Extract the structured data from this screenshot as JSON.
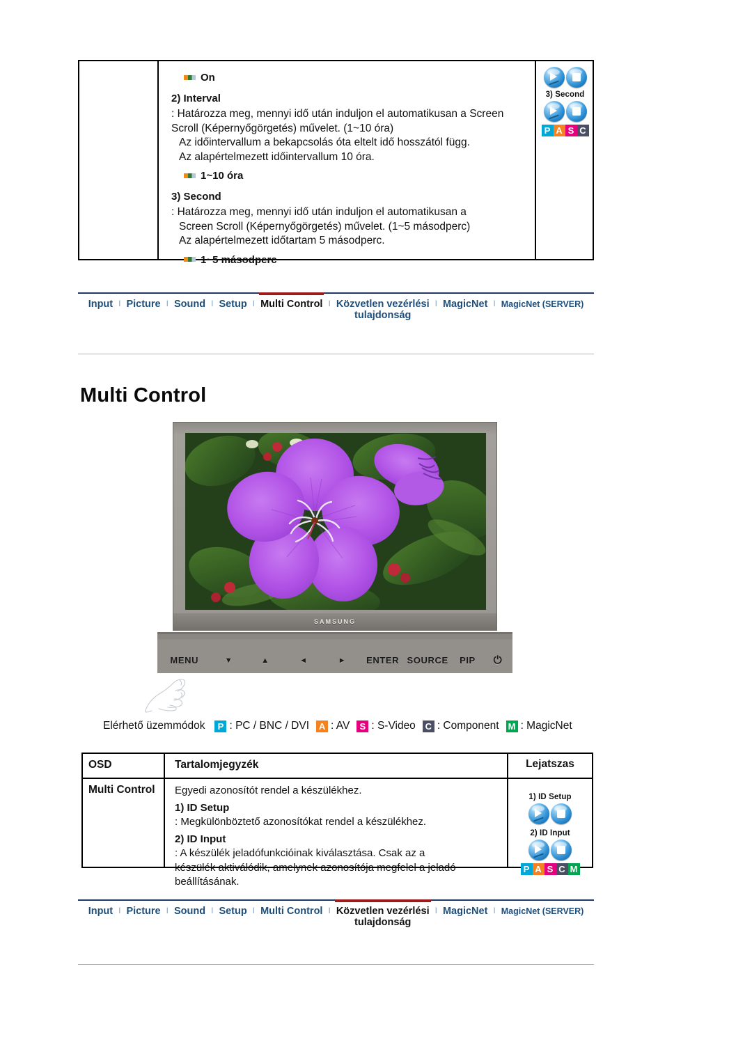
{
  "top_section": {
    "bullet_on": "On",
    "item2": {
      "title": "2) Interval",
      "lines": [
        ": Határozza meg, mennyi idő után induljon el automatikusan a Screen",
        "Scroll (Képernyőgörgetés) művelet. (1~10 óra)",
        "Az időintervallum a bekapcsolás óta eltelt idő hosszától függ.",
        "Az alapértelmezett időintervallum 10 óra."
      ],
      "bullet": "1~10 óra"
    },
    "item3": {
      "title": "3) Second",
      "lines": [
        ": Határozza meg, mennyi idő után induljon el automatikusan a",
        "Screen Scroll (Képernyőgörgetés) művelet. (1~5 másodperc)",
        "Az alapértelmezett időtartam 5 másodperc."
      ],
      "bullet": "1~5 másodperc"
    },
    "icon_label": "3) Second",
    "pasc": [
      "P",
      "A",
      "S",
      "C"
    ]
  },
  "nav_top": {
    "items": [
      {
        "label": "Input",
        "active": false
      },
      {
        "label": "Picture",
        "active": false
      },
      {
        "label": "Sound",
        "active": false
      },
      {
        "label": "Setup",
        "active": false
      },
      {
        "label": "Multi Control",
        "active": true
      },
      {
        "label": "Közvetlen vezérlési tulajdonság",
        "active": false
      },
      {
        "label": "MagicNet",
        "active": false
      },
      {
        "label": "MagicNet (SERVER)",
        "active": false
      }
    ],
    "separator": "I"
  },
  "nav_bottom": {
    "items": [
      {
        "label": "Input",
        "active": false
      },
      {
        "label": "Picture",
        "active": false
      },
      {
        "label": "Sound",
        "active": false
      },
      {
        "label": "Setup",
        "active": false
      },
      {
        "label": "Multi Control",
        "active": false
      },
      {
        "label": "Közvetlen vezérlési tulajdonság",
        "active": true
      },
      {
        "label": "MagicNet",
        "active": false
      },
      {
        "label": "MagicNet (SERVER)",
        "active": false
      }
    ],
    "separator": "I"
  },
  "heading": "Multi Control",
  "monitor": {
    "brand": "SAMSUNG",
    "buttons": [
      "MENU",
      "▼",
      "▲",
      "◄",
      "►",
      "ENTER",
      "SOURCE",
      "PIP",
      "⏻"
    ]
  },
  "legend": {
    "label": "Elérhető üzemmódok",
    "entries": [
      {
        "badge": "P",
        "text": ": PC / BNC / DVI",
        "color": "#00a8d8"
      },
      {
        "badge": "A",
        "text": ": AV",
        "color": "#f58220"
      },
      {
        "badge": "S",
        "text": ": S-Video",
        "color": "#e5007d"
      },
      {
        "badge": "C",
        "text": ": Component",
        "color": "#4b4f63"
      },
      {
        "badge": "M",
        "text": ": MagicNet",
        "color": "#00a64f"
      }
    ]
  },
  "table": {
    "headers": [
      "OSD",
      "Tartalomjegyzék",
      "Lejatszas"
    ],
    "row": {
      "osd": "Multi Control",
      "intro": "Egyedi azonosítót rendel a készülékhez.",
      "sub1_title": "1) ID Setup",
      "sub1_text": ": Megkülönböztető azonosítókat rendel a készülékhez.",
      "sub2_title": "2) ID Input",
      "sub2_lines": [
        ": A készülék jeladófunkcióinak kiválasztása. Csak az a",
        "készülék aktiválódik, amelynek azonosítója megfelel a jeladó",
        "beállításának."
      ],
      "icon1_label": "1) ID Setup",
      "icon2_label": "2) ID Input",
      "pascm": [
        "P",
        "A",
        "S",
        "C",
        "M"
      ]
    }
  }
}
